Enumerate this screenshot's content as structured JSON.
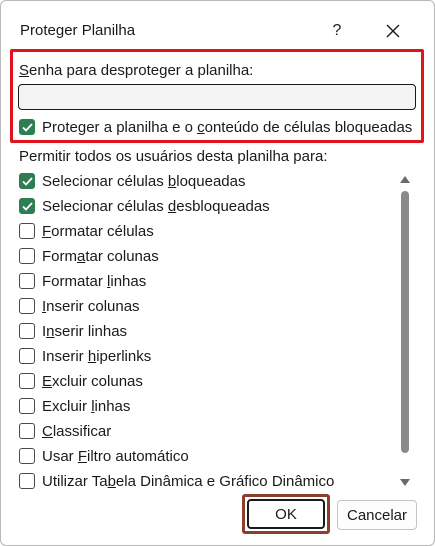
{
  "dialog": {
    "title": "Proteger Planilha",
    "help_label": "?"
  },
  "password": {
    "label_prefix": "S",
    "label_rest": "enha para desproteger a planilha:",
    "value": ""
  },
  "protect": {
    "checked": true,
    "label_a": "Proteger a planilha e o ",
    "label_u": "c",
    "label_b": "onteúdo de células bloqueadas"
  },
  "permissions": {
    "header": "Permitir todos os usuários desta planilha para:",
    "items": [
      {
        "before": "Selecionar células ",
        "u": "b",
        "after": "loqueadas",
        "checked": true
      },
      {
        "before": "Selecionar células ",
        "u": "d",
        "after": "esbloqueadas",
        "checked": true
      },
      {
        "before": "",
        "u": "F",
        "after": "ormatar células",
        "checked": false
      },
      {
        "before": "Form",
        "u": "a",
        "after": "tar colunas",
        "checked": false
      },
      {
        "before": "Formatar ",
        "u": "l",
        "after": "inhas",
        "checked": false
      },
      {
        "before": "",
        "u": "I",
        "after": "nserir colunas",
        "checked": false
      },
      {
        "before": "I",
        "u": "n",
        "after": "serir linhas",
        "checked": false
      },
      {
        "before": "Inserir ",
        "u": "h",
        "after": "iperlinks",
        "checked": false
      },
      {
        "before": "",
        "u": "E",
        "after": "xcluir colunas",
        "checked": false
      },
      {
        "before": "Excluir ",
        "u": "l",
        "after": "inhas",
        "checked": false
      },
      {
        "before": "",
        "u": "C",
        "after": "lassificar",
        "checked": false
      },
      {
        "before": "Usar ",
        "u": "F",
        "after": "iltro automático",
        "checked": false
      },
      {
        "before": "Utilizar Ta",
        "u": "b",
        "after": "ela Dinâmica e Gráfico Dinâmico",
        "checked": false
      }
    ]
  },
  "buttons": {
    "ok": "OK",
    "cancel": "Cancelar"
  },
  "colors": {
    "checkbox_checked": "#2f7d52",
    "highlight_red": "#e0141c",
    "highlight_brown": "#8b3f2c"
  },
  "icons": {
    "close": "close-icon",
    "check": "checkmark-icon",
    "scroll_up": "chevron-up-icon",
    "scroll_down": "chevron-down-icon"
  }
}
